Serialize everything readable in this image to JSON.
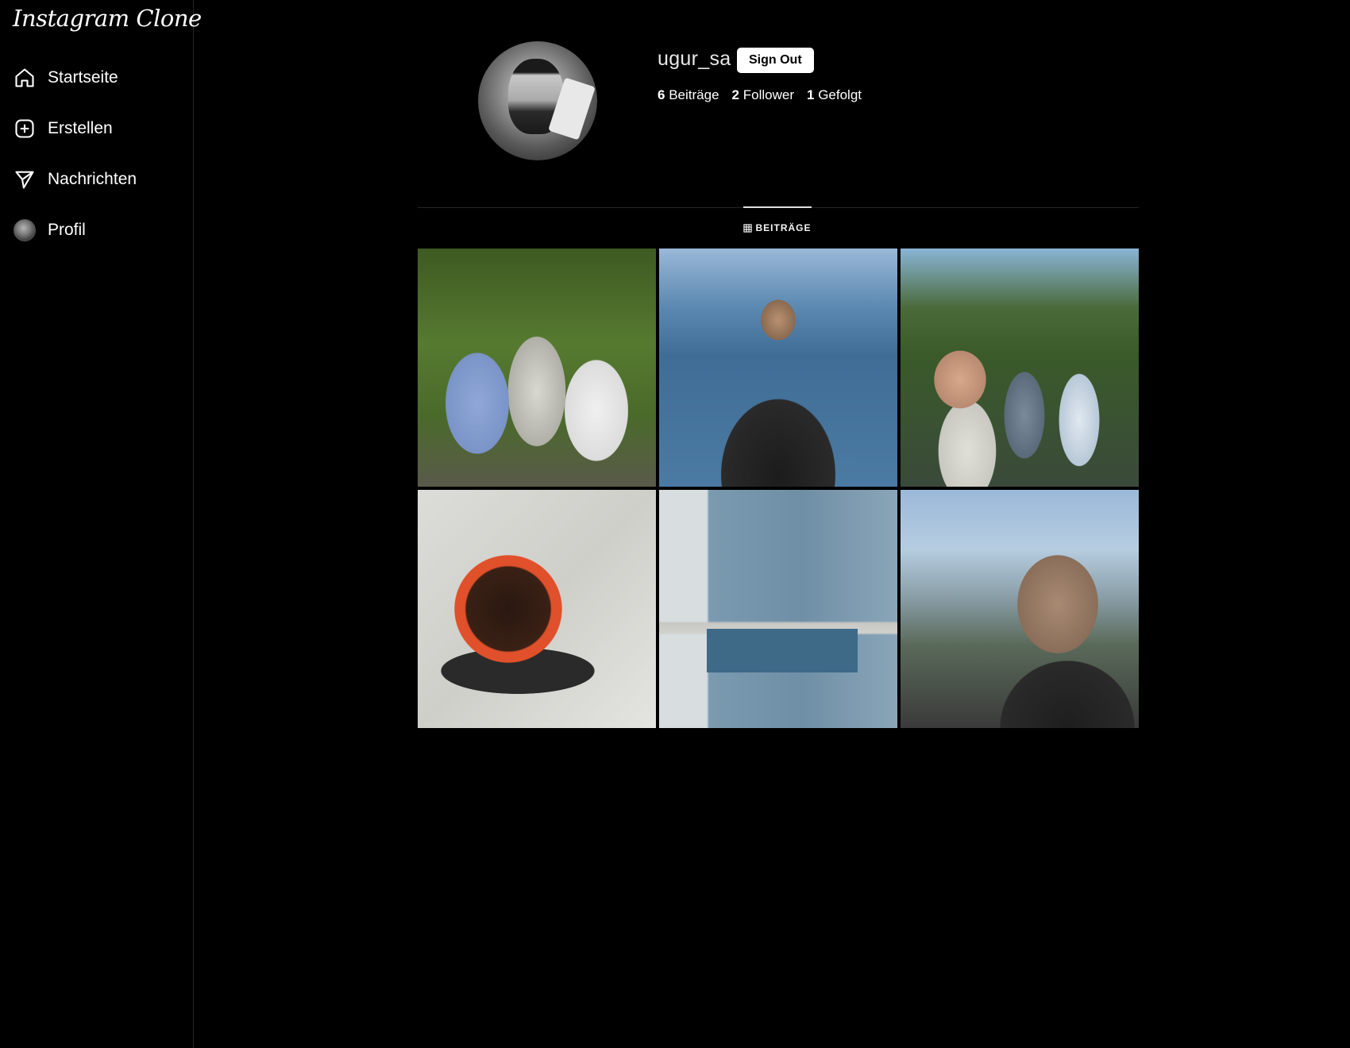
{
  "app": {
    "logo_text": "Instagram Clone"
  },
  "sidebar": {
    "items": [
      {
        "label": "Startseite",
        "icon": "home-icon"
      },
      {
        "label": "Erstellen",
        "icon": "plus-square-icon"
      },
      {
        "label": "Nachrichten",
        "icon": "send-icon"
      },
      {
        "label": "Profil",
        "icon": "avatar"
      }
    ]
  },
  "profile": {
    "username": "ugur_sa",
    "signout_label": "Sign Out",
    "stats": {
      "posts_count": "6",
      "posts_label": "Beiträge",
      "followers_count": "2",
      "followers_label": "Follower",
      "following_count": "1",
      "following_label": "Gefolgt"
    }
  },
  "tabs": {
    "posts_label": "BEITRÄGE",
    "icon": "grid-icon"
  },
  "colors": {
    "background": "#000000",
    "text": "#ffffff",
    "divider": "#262626",
    "button_bg": "#ffffff"
  }
}
